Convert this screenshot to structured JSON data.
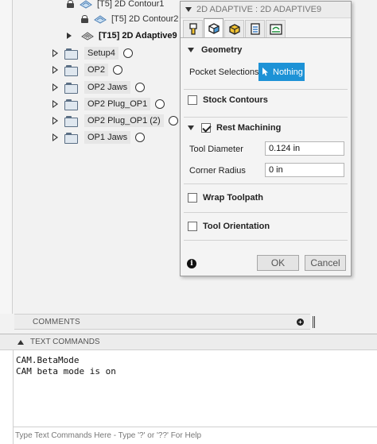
{
  "browser": {
    "ops": [
      {
        "label": "[T5] 2D Contour1",
        "bold": false,
        "locked": true
      },
      {
        "label": "[T5] 2D Contour2",
        "bold": false,
        "locked": true
      },
      {
        "label": "[T15] 2D Adaptive9",
        "bold": true,
        "locked": false
      }
    ],
    "setups": [
      {
        "label": "Setup4"
      },
      {
        "label": "OP2"
      },
      {
        "label": "OP2 Jaws"
      },
      {
        "label": "OP2 Plug_OP1"
      },
      {
        "label": "OP2 Plug_OP1 (2)"
      },
      {
        "label": "OP1 Jaws"
      }
    ]
  },
  "dialog": {
    "title": "2D ADAPTIVE : 2D ADAPTIVE9",
    "tabs": [
      "tool-icon",
      "geometry-icon",
      "heights-icon",
      "passes-icon",
      "linking-icon"
    ],
    "active_tab": 1,
    "geometry": {
      "heading": "Geometry",
      "pocket_label": "Pocket Selections",
      "pocket_value": "Nothing"
    },
    "stock_contours": {
      "heading": "Stock Contours",
      "checked": false
    },
    "rest_machining": {
      "heading": "Rest Machining",
      "checked": true,
      "tool_diameter_label": "Tool Diameter",
      "tool_diameter_value": "0.124 in",
      "corner_radius_label": "Corner Radius",
      "corner_radius_value": "0 in"
    },
    "wrap_toolpath": {
      "heading": "Wrap Toolpath",
      "checked": false
    },
    "tool_orientation": {
      "heading": "Tool Orientation",
      "checked": false
    },
    "ok_label": "OK",
    "cancel_label": "Cancel"
  },
  "comments": {
    "label": "COMMENTS"
  },
  "text_commands": {
    "title": "TEXT COMMANDS",
    "lines": [
      "CAM.BetaMode",
      "CAM beta mode is on"
    ],
    "placeholder": "Type Text Commands Here - Type '?' or '??' For Help"
  },
  "colors": {
    "accent": "#1d92d6",
    "canvas_brown": "#a89782"
  }
}
